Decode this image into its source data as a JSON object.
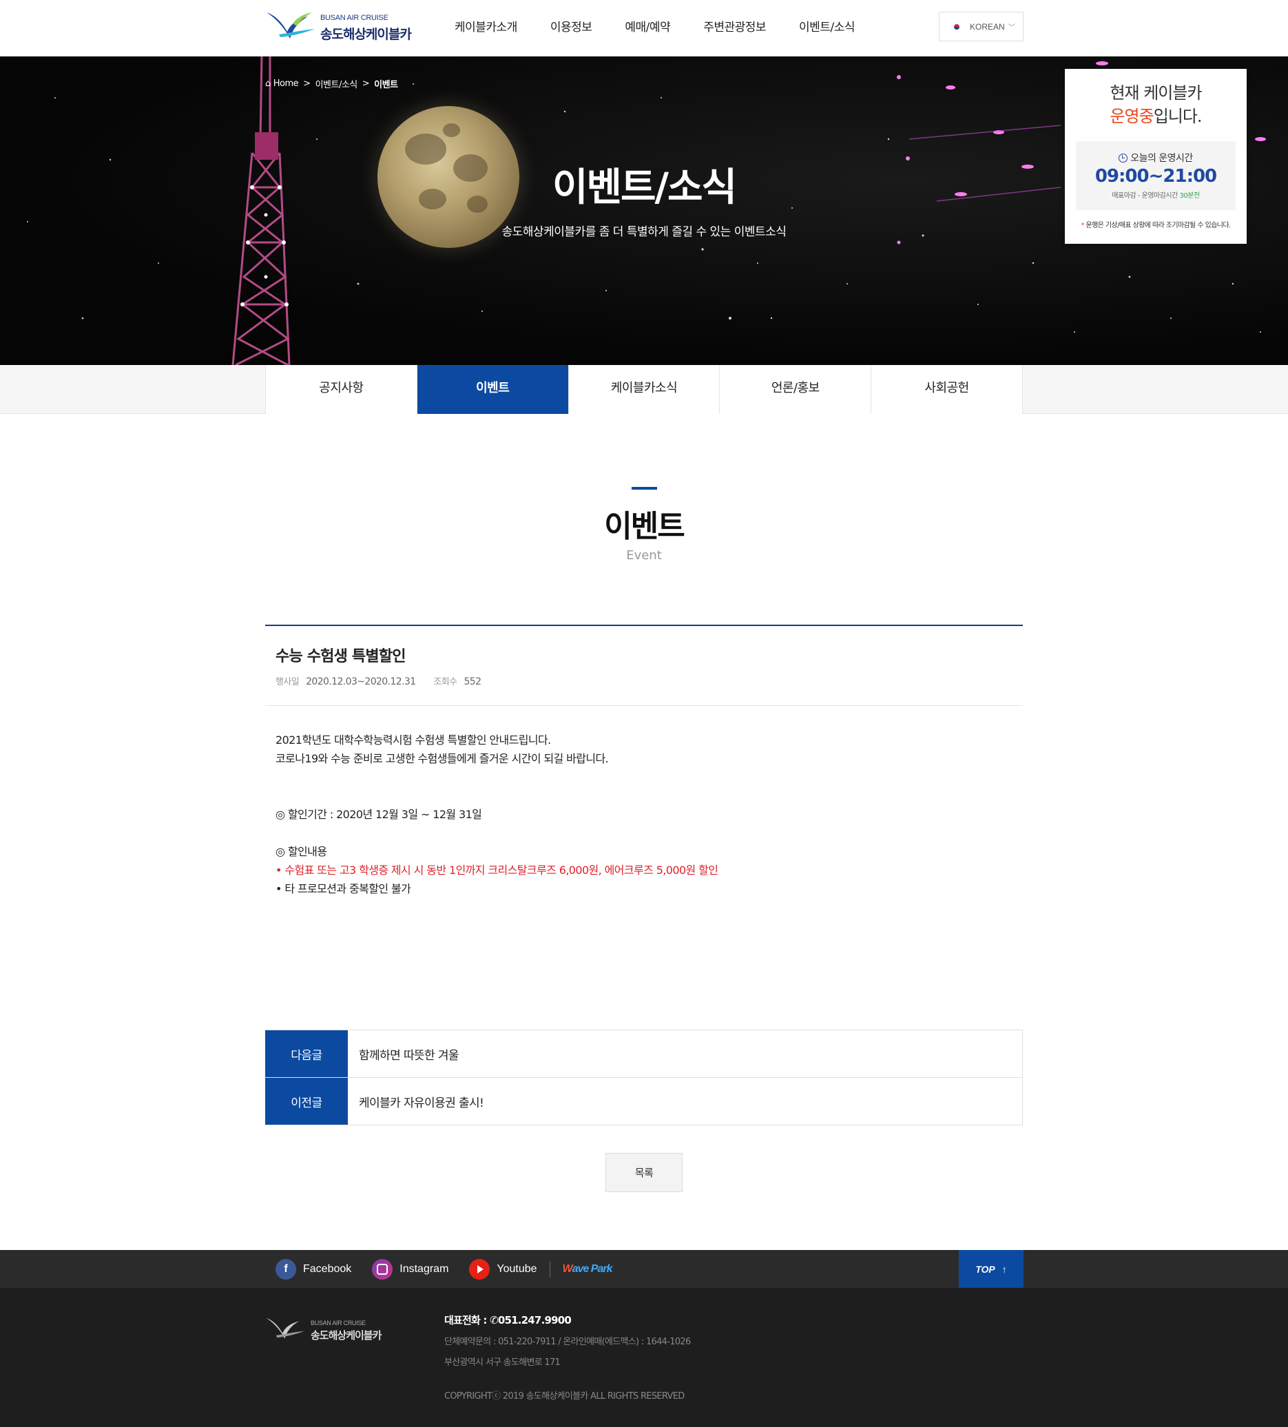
{
  "header": {
    "logo_en": "BUSAN AIR CRUISE",
    "logo_ko": "송도해상케이블카",
    "nav": [
      "케이블카소개",
      "이용정보",
      "예매/예약",
      "주변관광정보",
      "이벤트/소식"
    ],
    "language": "KOREAN"
  },
  "hero": {
    "breadcrumb": {
      "home": "Home",
      "parent": "이벤트/소식",
      "current": "이벤트"
    },
    "title": "이벤트/소식",
    "subtitle": "송도해상케이블카를 좀 더 특별하게 즐길 수 있는 이벤트소식"
  },
  "status": {
    "title_pre": "현재 케이블카",
    "title_on": "운영중",
    "title_post": "입니다.",
    "hours_label": "오늘의 운영시간",
    "hours_time": "09:00~21:00",
    "note_pre": "매표마감 - 운영마감시간 ",
    "note_green": "30분전",
    "footnote_mark": "*",
    "footnote": "운행은 기상/매표 상황에 따라 조기마감될 수 있습니다."
  },
  "subtabs": [
    "공지사항",
    "이벤트",
    "케이블카소식",
    "언론/홍보",
    "사회공헌"
  ],
  "subtab_active_index": 1,
  "page": {
    "title": "이벤트",
    "title_en": "Event"
  },
  "article": {
    "title": "수능 수험생 특별할인",
    "period_label": "행사일",
    "period": "2020.12.03~2020.12.31",
    "views_label": "조회수",
    "views": "552",
    "body": {
      "line1": "2021학년도 대학수학능력시험 수험생 특별할인 안내드립니다.",
      "line2": "코로나19와 수능 준비로 고생한 수험생들에게 즐거운 시간이 되길 바랍니다.",
      "period": "◎ 할인기간 : 2020년 12월 3일 ~ 12월 31일",
      "content_head": "◎ 할인내용",
      "bullet1": "• 수험표 또는 고3 학생증 제시 시 동반 1인까지 크리스탈크루즈 6,000원, 에어크루즈 5,000원 할인",
      "bullet2": "• 타 프로모션과 중복할인 불가"
    }
  },
  "nav_posts": {
    "next_label": "다음글",
    "next_title": "함께하면 따뜻한 겨울",
    "prev_label": "이전글",
    "prev_title": "케이블카 자유이용권 출시!"
  },
  "list_button": "목록",
  "footer": {
    "sns": [
      "Facebook",
      "Instagram",
      "Youtube"
    ],
    "wavepark_w": "W",
    "wavepark_rest": "ave Park",
    "top": "TOP",
    "logo_en": "BUSAN AIR CRUISE",
    "logo_ko": "송도해상케이블카",
    "tel_label": "대표전화 :",
    "tel": "051.247.9900",
    "group_line": "단체예약문의 : 051-220-7911 / 온라인예매(에드맥스) : 1644-1026",
    "address": "부산광역시 서구 송도해변로 171",
    "copyright": "COPYRIGHTⓒ 2019 송도해상케이블카 ALL RIGHTS RESERVED"
  },
  "colors": {
    "primary": "#0b4aa0",
    "accent_red": "#dd2229",
    "status_orange": "#e8461d",
    "footer_bg": "#1e1e1e"
  }
}
